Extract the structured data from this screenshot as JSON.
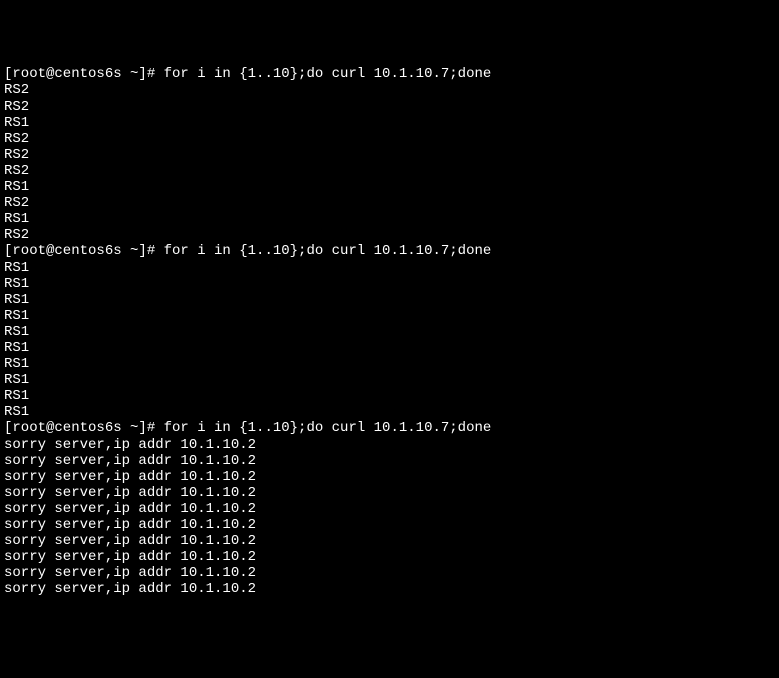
{
  "terminal": {
    "lines": [
      {
        "text": "[root@centos6s ~]# for i in {1..10};do curl 10.1.10.7;done",
        "type": "prompt"
      },
      {
        "text": "RS2",
        "type": "output"
      },
      {
        "text": "RS2",
        "type": "output"
      },
      {
        "text": "RS1",
        "type": "output"
      },
      {
        "text": "RS2",
        "type": "output"
      },
      {
        "text": "RS2",
        "type": "output"
      },
      {
        "text": "RS2",
        "type": "output"
      },
      {
        "text": "RS1",
        "type": "output"
      },
      {
        "text": "RS2",
        "type": "output"
      },
      {
        "text": "RS1",
        "type": "output"
      },
      {
        "text": "RS2",
        "type": "output"
      },
      {
        "text": "[root@centos6s ~]# for i in {1..10};do curl 10.1.10.7;done",
        "type": "prompt"
      },
      {
        "text": "RS1",
        "type": "output"
      },
      {
        "text": "RS1",
        "type": "output"
      },
      {
        "text": "RS1",
        "type": "output"
      },
      {
        "text": "RS1",
        "type": "output"
      },
      {
        "text": "RS1",
        "type": "output"
      },
      {
        "text": "RS1",
        "type": "output"
      },
      {
        "text": "RS1",
        "type": "output"
      },
      {
        "text": "RS1",
        "type": "output"
      },
      {
        "text": "RS1",
        "type": "output"
      },
      {
        "text": "RS1",
        "type": "output"
      },
      {
        "text": "[root@centos6s ~]# for i in {1..10};do curl 10.1.10.7;done",
        "type": "prompt"
      },
      {
        "text": "sorry server,ip addr 10.1.10.2",
        "type": "output"
      },
      {
        "text": "sorry server,ip addr 10.1.10.2",
        "type": "output"
      },
      {
        "text": "sorry server,ip addr 10.1.10.2",
        "type": "output"
      },
      {
        "text": "sorry server,ip addr 10.1.10.2",
        "type": "output"
      },
      {
        "text": "sorry server,ip addr 10.1.10.2",
        "type": "output"
      },
      {
        "text": "sorry server,ip addr 10.1.10.2",
        "type": "output"
      },
      {
        "text": "sorry server,ip addr 10.1.10.2",
        "type": "output"
      },
      {
        "text": "sorry server,ip addr 10.1.10.2",
        "type": "output"
      },
      {
        "text": "sorry server,ip addr 10.1.10.2",
        "type": "output"
      },
      {
        "text": "sorry server,ip addr 10.1.10.2",
        "type": "output"
      }
    ]
  }
}
